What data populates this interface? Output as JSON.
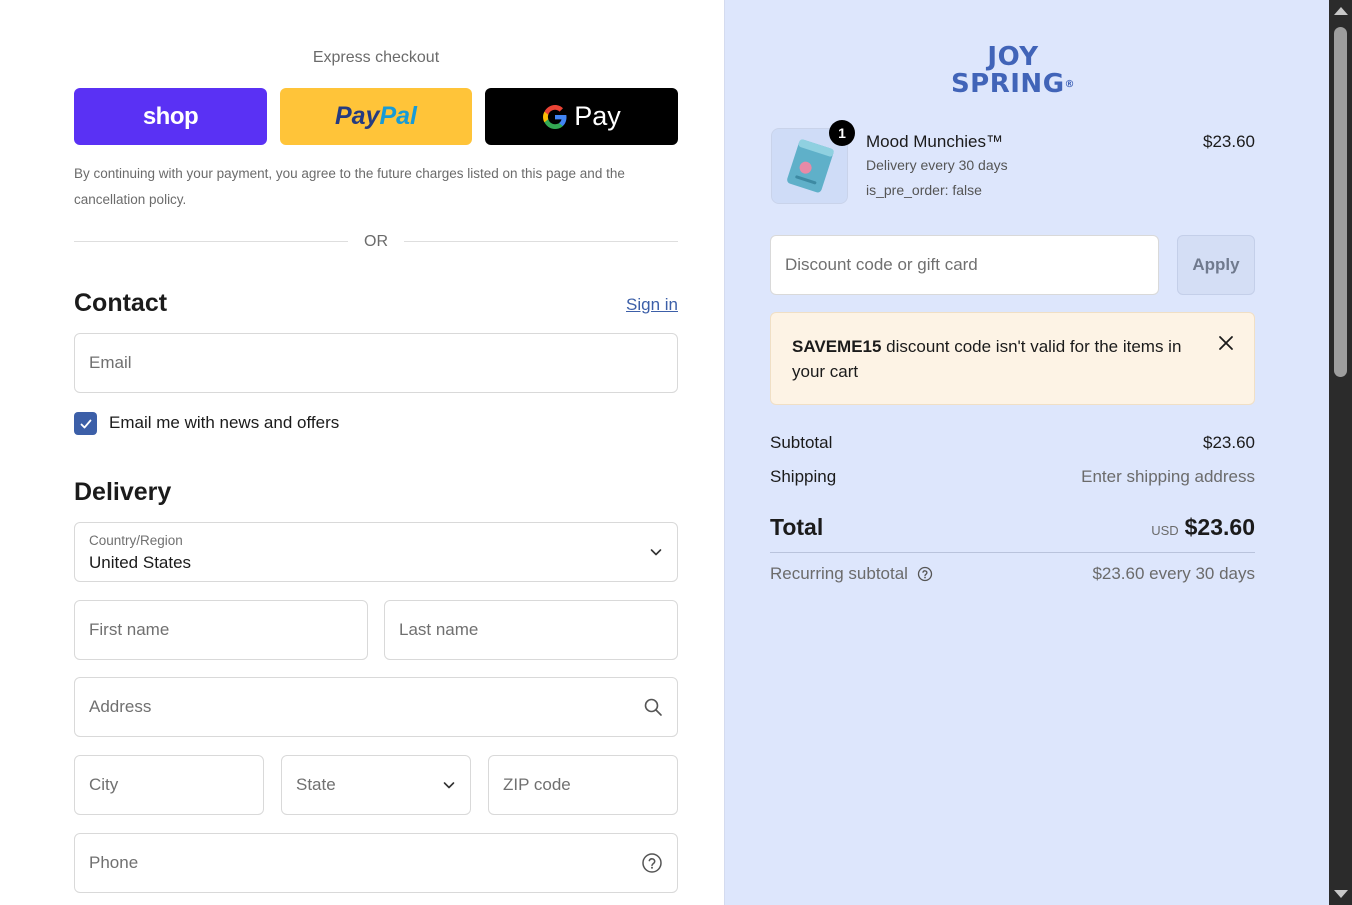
{
  "express": {
    "title": "Express checkout",
    "shop_label": "shop",
    "paypal_part1": "Pay",
    "paypal_part2": "Pal",
    "gpay_label": "Pay",
    "legal": "By continuing with your payment, you agree to the future charges listed on this page and the cancellation policy.",
    "or": "OR"
  },
  "contact": {
    "heading": "Contact",
    "sign_in": "Sign in",
    "email_placeholder": "Email",
    "newsletter_label": "Email me with news and offers",
    "newsletter_checked": true
  },
  "delivery": {
    "heading": "Delivery",
    "country_label": "Country/Region",
    "country_value": "United States",
    "first_name": "First name",
    "last_name": "Last name",
    "address": "Address",
    "city": "City",
    "state": "State",
    "zip": "ZIP code",
    "phone": "Phone"
  },
  "brand": {
    "line1": "JOY",
    "line2": "SPRING",
    "mark": "®"
  },
  "cart": {
    "item": {
      "quantity": "1",
      "name": "Mood Munchies™",
      "delivery": "Delivery every 30 days",
      "meta": "is_pre_order: false",
      "price": "$23.60"
    },
    "discount_placeholder": "Discount code or gift card",
    "apply_label": "Apply",
    "notice": {
      "code": "SAVEME15",
      "message": " discount code isn't valid for the items in your cart"
    },
    "subtotal_label": "Subtotal",
    "subtotal_value": "$23.60",
    "shipping_label": "Shipping",
    "shipping_value": "Enter shipping address",
    "total_label": "Total",
    "total_currency": "USD",
    "total_value": "$23.60",
    "recurring_label": "Recurring subtotal",
    "recurring_value": "$23.60 every 30 days"
  },
  "colors": {
    "shop": "#5a31f4",
    "paypal": "#ffc439",
    "accent": "#3c5fa8",
    "summary_bg": "#dde6fc",
    "notice_bg": "#fdf3e5"
  }
}
